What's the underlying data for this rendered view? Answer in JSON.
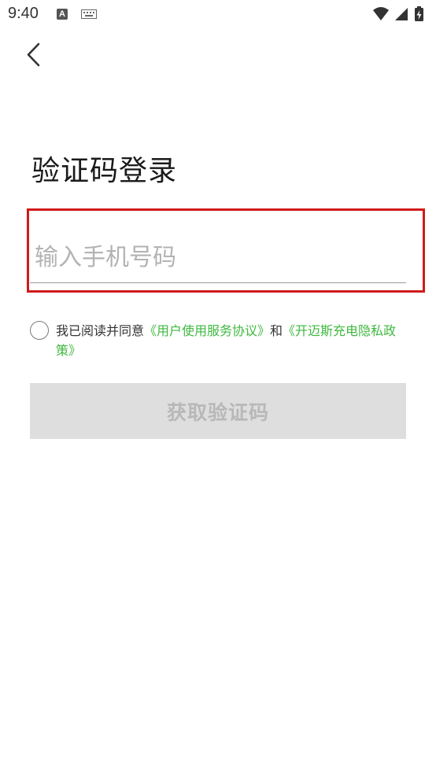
{
  "status_bar": {
    "time": "9:40",
    "notification_icons": [
      "text-a-icon",
      "keyboard-icon"
    ],
    "system_icons": [
      "wifi-icon",
      "signal-icon",
      "battery-charging-icon"
    ]
  },
  "header": {
    "back_icon": "chevron-left-icon"
  },
  "title": "验证码登录",
  "phone": {
    "placeholder": "输入手机号码",
    "value": "",
    "highlight_color": "#d11a1a"
  },
  "agreement": {
    "prefix": "我已阅读并同意",
    "link_terms": "《用户使用服务协议》",
    "conjunction": "和",
    "link_privacy": "《开迈斯充电隐私政策》",
    "checked": false,
    "link_color": "#3fb83f"
  },
  "get_code_button": {
    "label": "获取验证码",
    "enabled": false
  }
}
